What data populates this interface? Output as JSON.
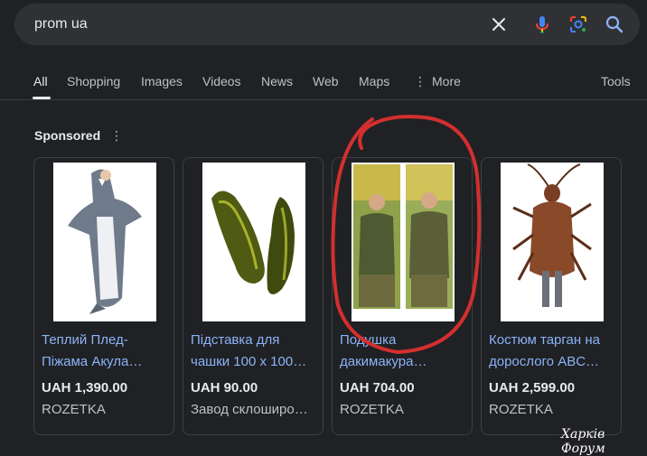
{
  "search": {
    "query": "prom ua"
  },
  "icons": {
    "clear": "close-icon",
    "voice": "microphone-icon",
    "lens": "camera-lens-icon",
    "search": "search-icon"
  },
  "tabs": {
    "all": "All",
    "shopping": "Shopping",
    "images": "Images",
    "videos": "Videos",
    "news": "News",
    "web": "Web",
    "maps": "Maps",
    "more": "More",
    "tools": "Tools"
  },
  "sponsored": {
    "label": "Sponsored"
  },
  "products": [
    {
      "title": "Теплий Плед-Піжама Акула…",
      "price": "UAH 1,390.00",
      "store": "ROZETKA"
    },
    {
      "title": "Підставка для чашки 100 х 100…",
      "price": "UAH 90.00",
      "store": "Завод склоширо…"
    },
    {
      "title": "Подушка дакимакура…",
      "price": "UAH 704.00",
      "store": "ROZETKA"
    },
    {
      "title": "Костюм тарган на дорослого ABC…",
      "price": "UAH 2,599.00",
      "store": "ROZETKA"
    }
  ],
  "watermark": "Харків Форум",
  "colors": {
    "link": "#8ab4f8",
    "background": "#202124",
    "annotation": "#d32f2f"
  }
}
